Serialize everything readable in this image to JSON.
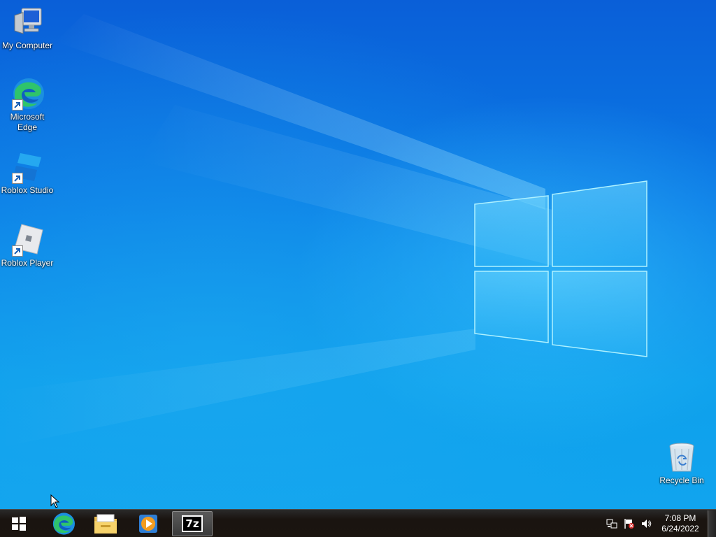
{
  "desktop": {
    "icons": [
      {
        "label": "My Computer",
        "icon": "computer-icon",
        "shortcut": false
      },
      {
        "label": "Microsoft Edge",
        "icon": "edge-icon",
        "shortcut": true
      },
      {
        "label": "Roblox Studio",
        "icon": "roblox-studio-icon",
        "shortcut": true
      },
      {
        "label": "Roblox Player",
        "icon": "roblox-player-icon",
        "shortcut": true
      },
      {
        "label": "Recycle Bin",
        "icon": "recycle-bin-icon",
        "shortcut": false
      }
    ]
  },
  "taskbar": {
    "start_icon": "windows-logo-icon",
    "pinned": [
      {
        "icon": "edge-icon",
        "active": false
      },
      {
        "icon": "file-explorer-icon",
        "active": false
      },
      {
        "icon": "media-player-icon",
        "active": false
      },
      {
        "icon": "7zip-icon",
        "label": "7z",
        "active": true
      }
    ],
    "tray_icons": [
      "network-icon",
      "action-center-flag-icon",
      "volume-icon"
    ],
    "clock": {
      "time": "7:08 PM",
      "date": "6/24/2022"
    }
  },
  "colors": {
    "wallpaper_top": "#0a5fd8",
    "wallpaper_bottom": "#11a4ee",
    "taskbar": "#1b1510"
  }
}
